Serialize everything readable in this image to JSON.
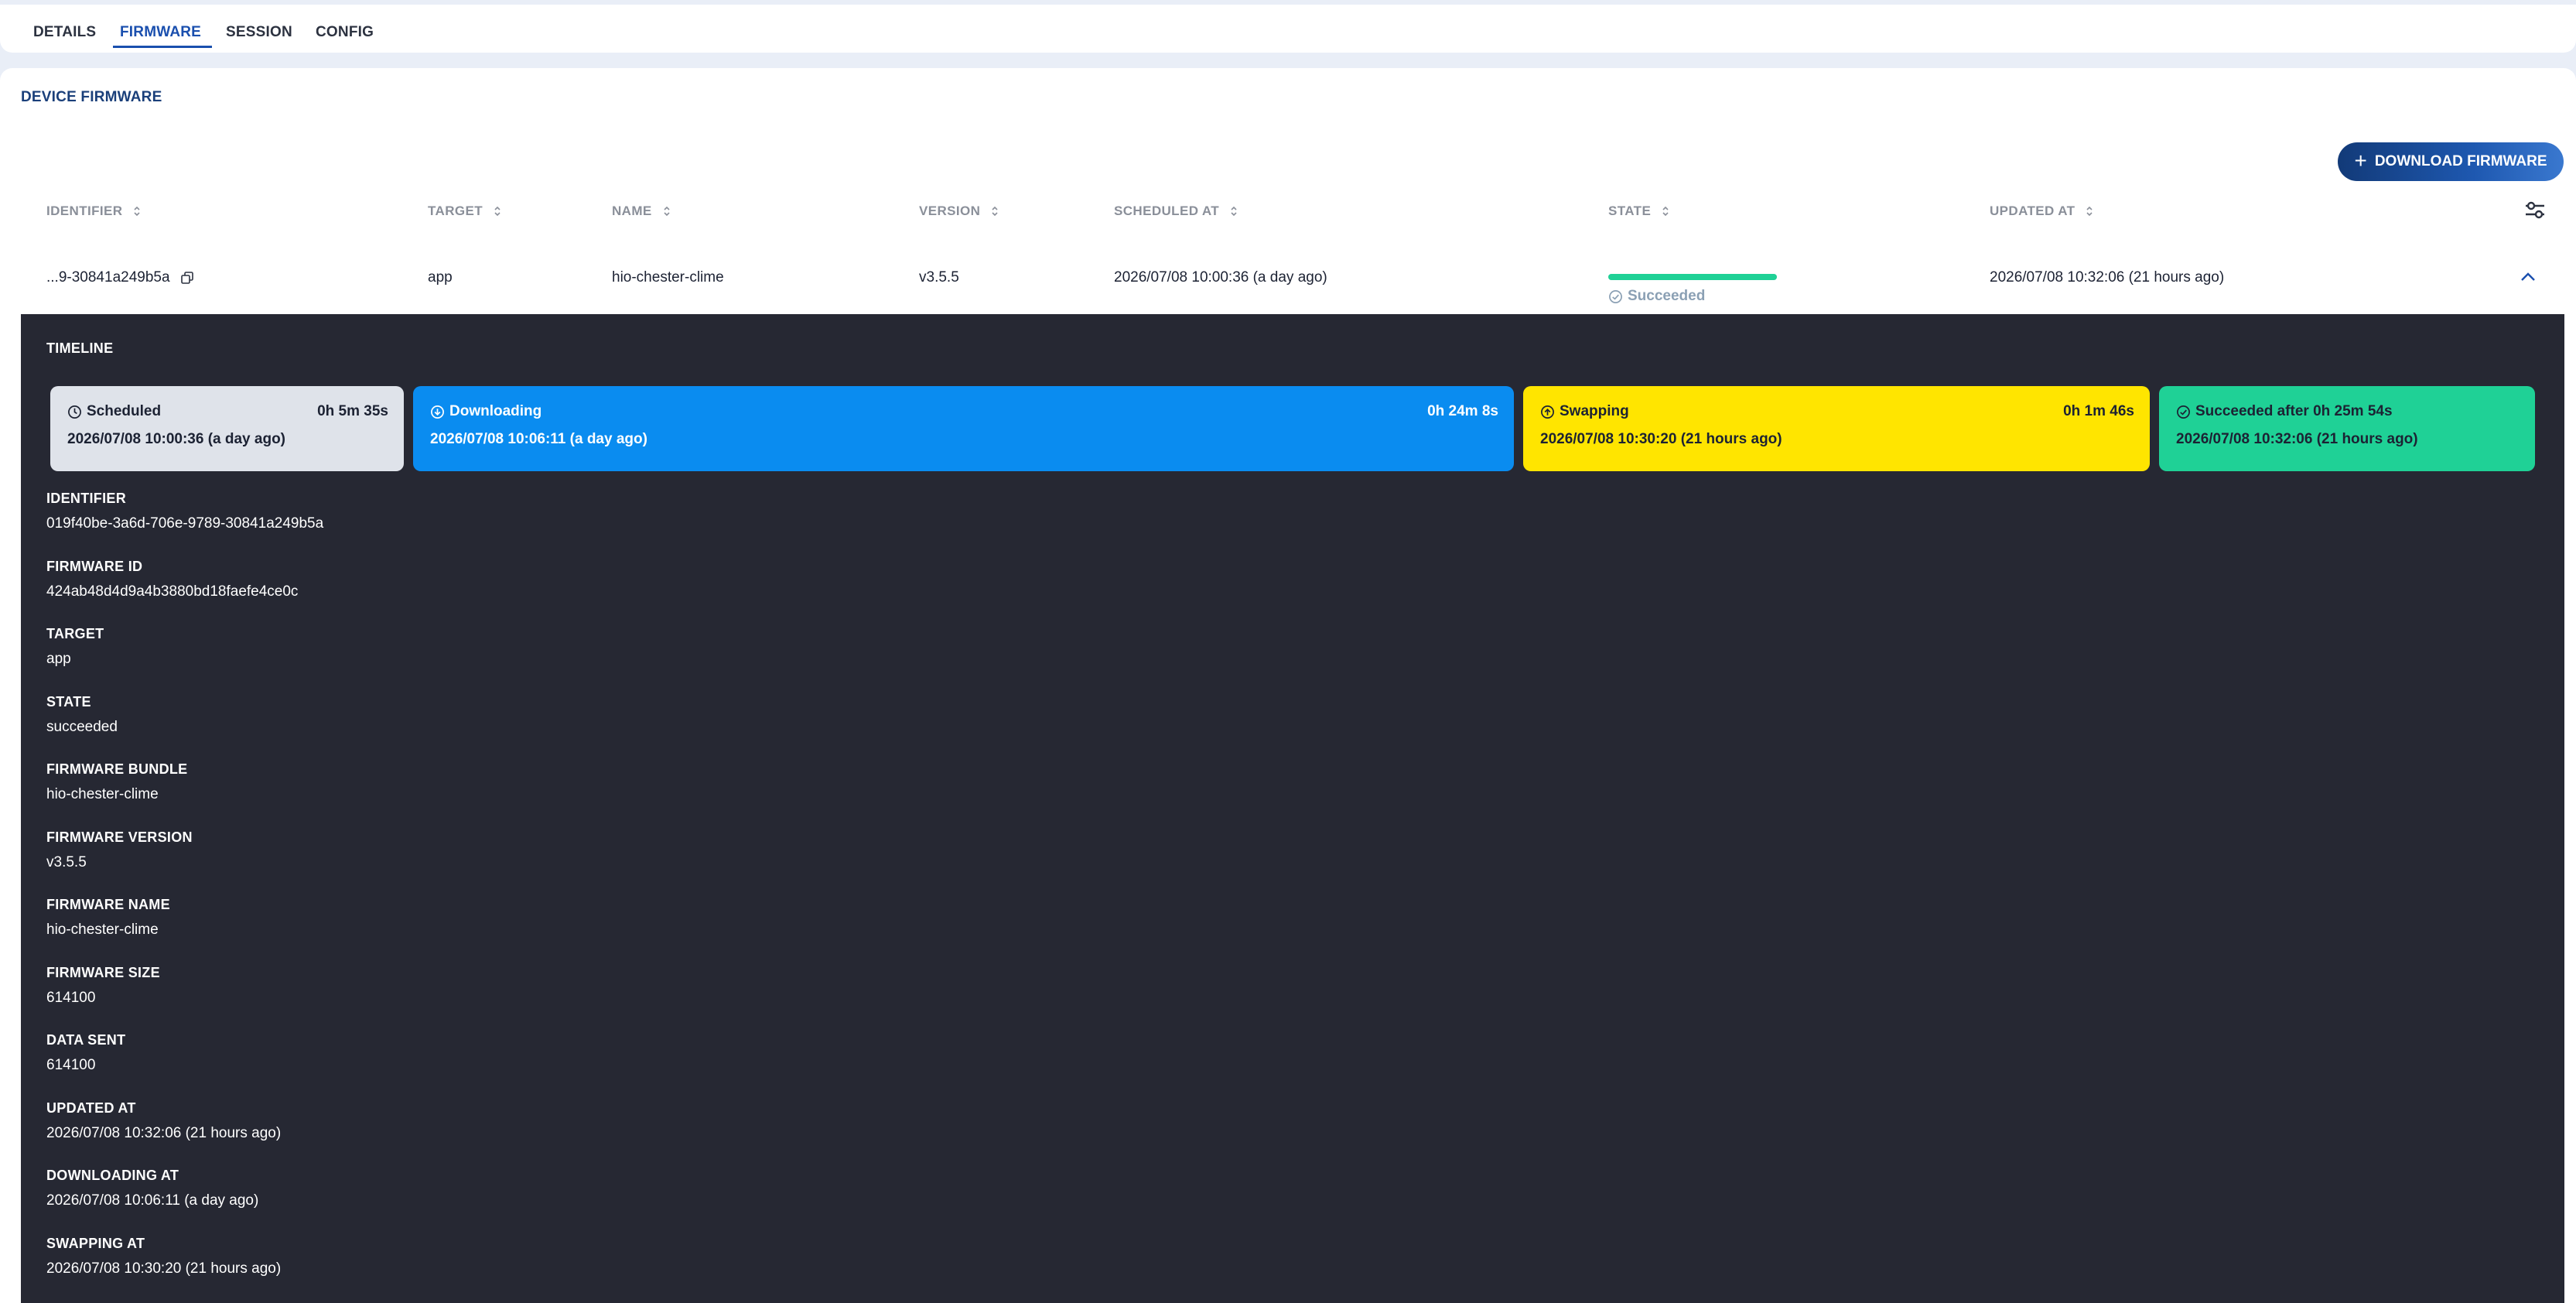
{
  "tabs": [
    {
      "label": "DETAILS"
    },
    {
      "label": "FIRMWARE"
    },
    {
      "label": "SESSION"
    },
    {
      "label": "CONFIG"
    }
  ],
  "active_tab": "FIRMWARE",
  "section_title": "DEVICE FIRMWARE",
  "download_button": "DOWNLOAD FIRMWARE",
  "table": {
    "headers": [
      "IDENTIFIER",
      "TARGET",
      "NAME",
      "VERSION",
      "SCHEDULED AT",
      "STATE",
      "UPDATED AT"
    ],
    "row": {
      "identifier": "...9-30841a249b5a",
      "target": "app",
      "name": "hio-chester-clime",
      "version": "v3.5.5",
      "scheduled_at": "2026/07/08 10:00:36 (a day ago)",
      "state": "Succeeded",
      "state_progress": 1.0,
      "updated_at": "2026/07/08 10:32:06 (21 hours ago)"
    }
  },
  "timeline": {
    "title": "TIMELINE",
    "segments": [
      {
        "label": "Scheduled",
        "duration": "0h 5m 35s",
        "date": "2026/07/08 10:00:36 (a day ago)",
        "color": "#dfe3ea",
        "text_color": "#1c2233",
        "icon": "clock-icon"
      },
      {
        "label": "Downloading",
        "duration": "0h 24m 8s",
        "date": "2026/07/08 10:06:11 (a day ago)",
        "color": "#0a8cf0",
        "text_color": "#ffffff",
        "icon": "download-icon"
      },
      {
        "label": "Swapping",
        "duration": "0h 1m 46s",
        "date": "2026/07/08 10:30:20 (21 hours ago)",
        "color": "#ffe500",
        "text_color": "#1c2233",
        "icon": "swap-icon"
      },
      {
        "label": "Succeeded after 0h 25m 54s",
        "duration": "",
        "date": "2026/07/08 10:32:06 (21 hours ago)",
        "color": "#1fd196",
        "text_color": "#1c2233",
        "icon": "check-circle-icon"
      }
    ]
  },
  "details": [
    {
      "label": "IDENTIFIER",
      "value": "019f40be-3a6d-706e-9789-30841a249b5a"
    },
    {
      "label": "FIRMWARE ID",
      "value": "424ab48d4d9a4b3880bd18faefe4ce0c"
    },
    {
      "label": "TARGET",
      "value": "app"
    },
    {
      "label": "STATE",
      "value": "succeeded"
    },
    {
      "label": "FIRMWARE BUNDLE",
      "value": "hio-chester-clime"
    },
    {
      "label": "FIRMWARE VERSION",
      "value": "v3.5.5"
    },
    {
      "label": "FIRMWARE NAME",
      "value": "hio-chester-clime"
    },
    {
      "label": "FIRMWARE SIZE",
      "value": "614100"
    },
    {
      "label": "DATA SENT",
      "value": "614100"
    },
    {
      "label": "UPDATED AT",
      "value": "2026/07/08 10:32:06 (21 hours ago)"
    },
    {
      "label": "DOWNLOADING AT",
      "value": "2026/07/08 10:06:11 (a day ago)"
    },
    {
      "label": "SWAPPING AT",
      "value": "2026/07/08 10:30:20 (21 hours ago)"
    }
  ],
  "colors": {
    "accent": "#1a4fae",
    "panel_bg": "#262833",
    "success": "#1fd196"
  }
}
